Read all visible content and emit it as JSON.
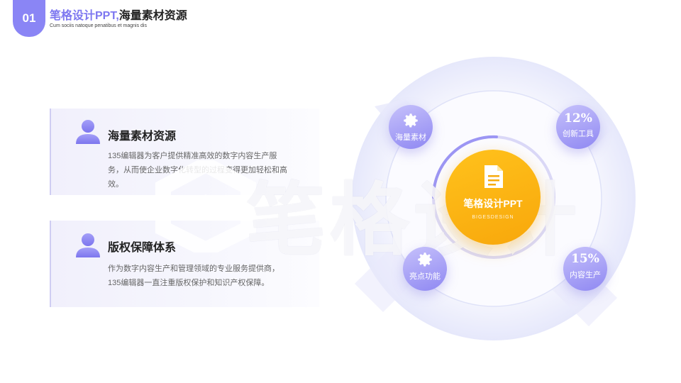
{
  "header": {
    "number": "01",
    "title_accent": "笔格设计PPT,",
    "title_main": "海量素材资源",
    "subtitle": "Cum sociis natoque penatibus et magnis dis"
  },
  "cards": [
    {
      "title": "海量素材资源",
      "text": "135编辑器为客户提供精准高效的数字内容生产服务，从而使企业数字化转型的过程变得更加轻松和高效。",
      "icon": "person-icon"
    },
    {
      "title": "版权保障体系",
      "text": "作为数字内容生产和管理领域的专业服务提供商，135编辑器一直注重版权保护和知识产权保障。",
      "icon": "person-icon"
    }
  ],
  "watermark": {
    "text": "笔格设计"
  },
  "diagram": {
    "center_title": "笔格设计PPT",
    "center_sub": "BIGESDESIGN",
    "center_icon": "document-icon",
    "nodes": [
      {
        "label": "海量素材",
        "icon": "gear-icon"
      },
      {
        "value": "12%",
        "label": "创新工具"
      },
      {
        "label": "亮点功能",
        "icon": "gear-icon"
      },
      {
        "value": "15%",
        "label": "内容生产"
      }
    ]
  },
  "colors": {
    "accent": "#8a85f5",
    "center": "#fbb416",
    "ring": "#eef0fd"
  }
}
